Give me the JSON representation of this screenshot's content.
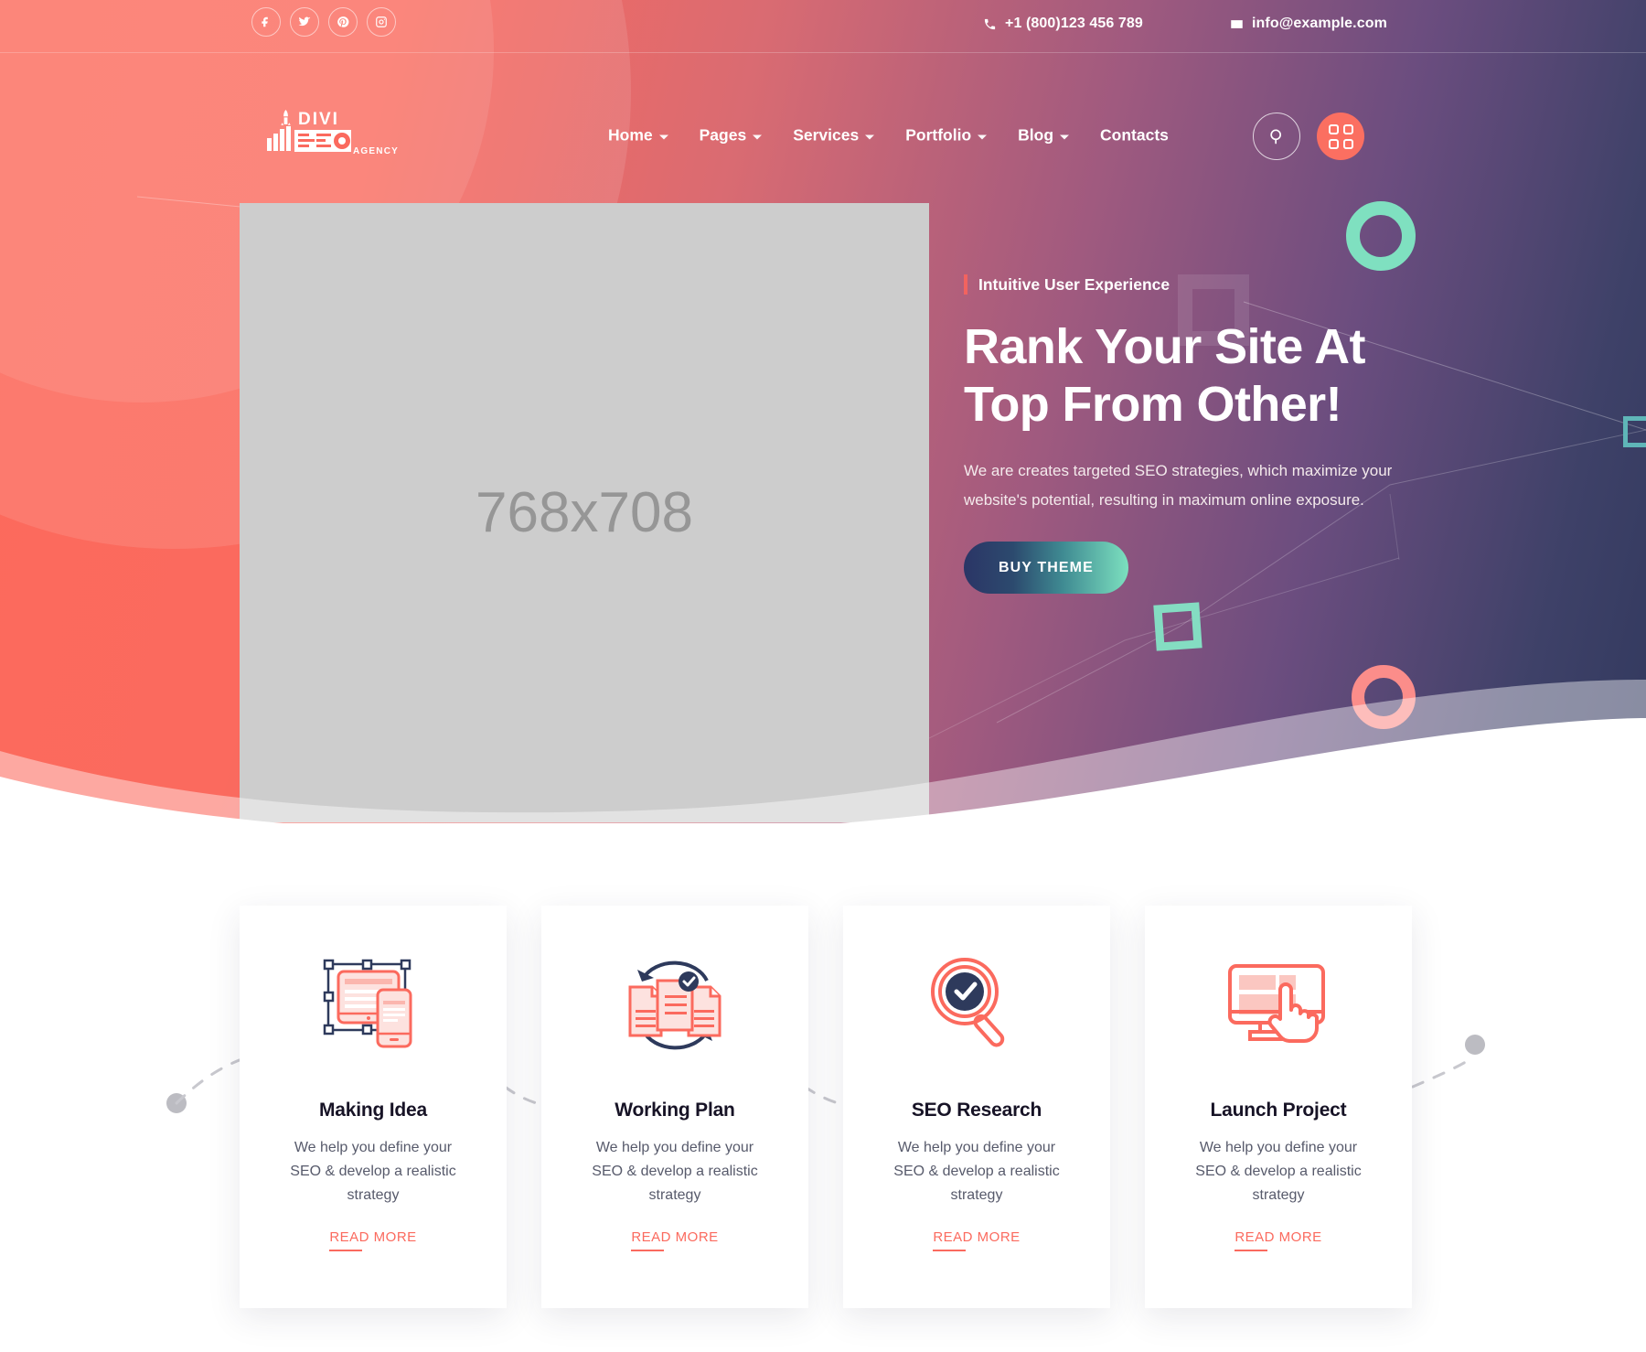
{
  "topbar": {
    "social": [
      {
        "name": "facebook-icon",
        "label": "Facebook"
      },
      {
        "name": "twitter-icon",
        "label": "Twitter"
      },
      {
        "name": "pinterest-icon",
        "label": "Pinterest"
      },
      {
        "name": "instagram-icon",
        "label": "Instagram"
      }
    ],
    "phone": "+1 (800)123 456 789",
    "email": "info@example.com"
  },
  "header": {
    "logo": {
      "line1": "DIVI",
      "line2": "SEO",
      "line3": "AGENCY"
    },
    "menu": [
      {
        "label": "Home",
        "has_dropdown": true
      },
      {
        "label": "Pages",
        "has_dropdown": true
      },
      {
        "label": "Services",
        "has_dropdown": true
      },
      {
        "label": "Portfolio",
        "has_dropdown": true
      },
      {
        "label": "Blog",
        "has_dropdown": true
      },
      {
        "label": "Contacts",
        "has_dropdown": false
      }
    ],
    "search_label": "Search",
    "grid_label": "Menu"
  },
  "hero": {
    "image_placeholder": "768x708",
    "eyebrow": "Intuitive User Experience",
    "title": "Rank Your Site At\nTop From Other!",
    "subtitle": "We are creates targeted SEO strategies, which maximize your website's potential, resulting in maximum online exposure.",
    "cta_label": "BUY THEME"
  },
  "cards": [
    {
      "icon": "responsive-design-icon",
      "title": "Making Idea",
      "text": "We help you define your SEO & develop a realistic strategy",
      "link": "READ MORE"
    },
    {
      "icon": "documents-cycle-icon",
      "title": "Working Plan",
      "text": "We help you define your SEO & develop a realistic strategy",
      "link": "READ MORE"
    },
    {
      "icon": "magnifier-check-icon",
      "title": "SEO Research",
      "text": "We help you define your SEO & develop a realistic strategy",
      "link": "READ MORE"
    },
    {
      "icon": "monitor-click-icon",
      "title": "Launch Project",
      "text": "We help you define your SEO & develop a realistic strategy",
      "link": "READ MORE"
    }
  ],
  "colors": {
    "coral": "#fb6a5e",
    "coral_dark": "#f2635f",
    "navy": "#2b3566",
    "mint": "#7fe0c0",
    "teal": "#5fb6b8",
    "card_title": "#171326",
    "card_text": "#575a6b",
    "placeholder_bg": "#cdcdcd"
  }
}
